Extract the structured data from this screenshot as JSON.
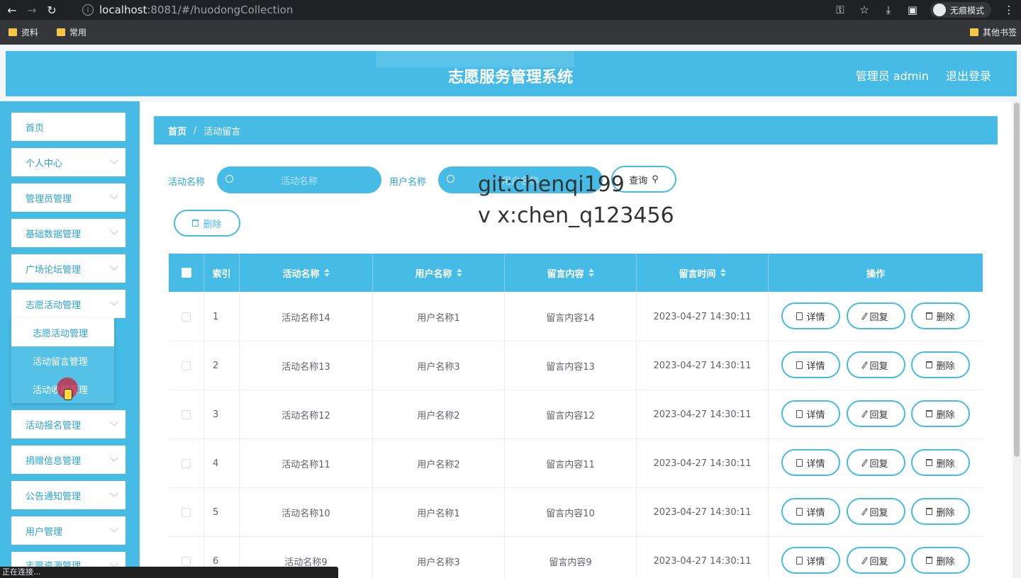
{
  "browser": {
    "url_host": "localhost",
    "url_path": ":8081/#/huodongCollection",
    "incognito_label": "无痕模式",
    "bookmarks": [
      "资料",
      "常用"
    ],
    "bookmarks_right": "其他书签",
    "status": "正在连接..."
  },
  "header": {
    "title": "志愿服务管理系统",
    "user": "管理员 admin",
    "logout": "退出登录"
  },
  "sidebar": {
    "items": [
      {
        "label": "首页"
      },
      {
        "label": "个人中心"
      },
      {
        "label": "管理员管理"
      },
      {
        "label": "基础数据管理"
      },
      {
        "label": "广场论坛管理"
      },
      {
        "label": "志愿活动管理"
      },
      {
        "label": "活动报名管理"
      },
      {
        "label": "捐赠信息管理"
      },
      {
        "label": "公告通知管理"
      },
      {
        "label": "用户管理"
      },
      {
        "label": "志愿资源管理"
      }
    ],
    "submenu": [
      "志愿活动管理",
      "活动留言管理",
      "活动收藏管理"
    ]
  },
  "breadcrumb": {
    "home": "首页",
    "sep": "/",
    "current": "活动留言"
  },
  "search": {
    "activity_label": "活动名称",
    "activity_placeholder": "活动名称",
    "user_label": "用户名称",
    "user_placeholder": "用户名称",
    "query_button": "查询",
    "delete_button": "删除"
  },
  "watermark": {
    "line1": "git:chenqi199",
    "line2": "v x:chen_q123456"
  },
  "table": {
    "headers": {
      "index": "索引",
      "activity": "活动名称",
      "user": "用户名称",
      "content": "留言内容",
      "time": "留言时间",
      "ops": "操作"
    },
    "actions": {
      "detail": "详情",
      "reply": "回复",
      "delete": "删除"
    },
    "rows": [
      {
        "index": "1",
        "activity": "活动名称14",
        "user": "用户名称1",
        "content": "留言内容14",
        "time": "2023-04-27 14:30:11"
      },
      {
        "index": "2",
        "activity": "活动名称13",
        "user": "用户名称3",
        "content": "留言内容13",
        "time": "2023-04-27 14:30:11"
      },
      {
        "index": "3",
        "activity": "活动名称12",
        "user": "用户名称2",
        "content": "留言内容12",
        "time": "2023-04-27 14:30:11"
      },
      {
        "index": "4",
        "activity": "活动名称11",
        "user": "用户名称2",
        "content": "留言内容11",
        "time": "2023-04-27 14:30:11"
      },
      {
        "index": "5",
        "activity": "活动名称10",
        "user": "用户名称1",
        "content": "留言内容10",
        "time": "2023-04-27 14:30:11"
      },
      {
        "index": "6",
        "activity": "活动名称9",
        "user": "用户名称3",
        "content": "留言内容9",
        "time": "2023-04-27 14:30:11"
      }
    ]
  }
}
